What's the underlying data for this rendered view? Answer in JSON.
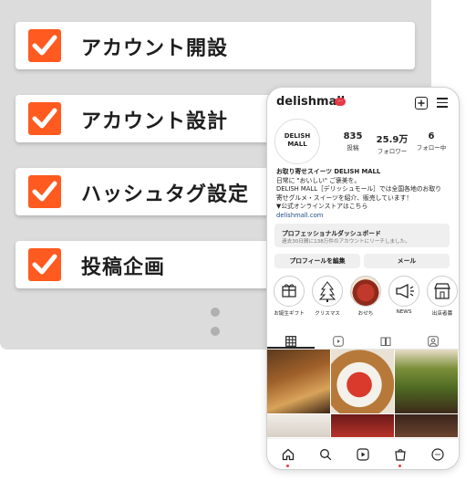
{
  "checklist": {
    "items": [
      {
        "label": "アカウント開設",
        "checked": true
      },
      {
        "label": "アカウント設計",
        "checked": true
      },
      {
        "label": "ハッシュタグ設定",
        "checked": true
      },
      {
        "label": "投稿企画",
        "checked": true
      }
    ],
    "accent_color": "#ff5a1f"
  },
  "phone": {
    "handle": "delishmall",
    "badge": "···",
    "avatar_text_1": "DELISH",
    "avatar_text_2": "MALL",
    "stats": [
      {
        "value": "835",
        "label": "投稿"
      },
      {
        "value": "25.9万",
        "label": "フォロワー"
      },
      {
        "value": "6",
        "label": "フォロー中"
      }
    ],
    "bio": {
      "name": "お取り寄せスイーツ DELISH MALL",
      "lines": [
        "日常に \"おいしい\" ご褒美を。",
        "DELISH MALL［デリッシュモール］では全国各地のお取り",
        "寄せグルメ・スイーツを紹介、販売しています！",
        "▼公式オンラインストアはこちら"
      ],
      "link": "delishmall.com"
    },
    "dashboard": {
      "title": "プロフェッショナルダッシュボード",
      "subtitle": "過去30日間に138万件のアカウントにリーチしました。"
    },
    "buttons": {
      "edit_profile": "プロフィールを編集",
      "email": "メール"
    },
    "highlights": [
      {
        "label": "お誕生ギフト",
        "icon": "gift-icon"
      },
      {
        "label": "クリスマス",
        "icon": "christmas-tree-icon"
      },
      {
        "label": "おせち",
        "icon": "osechi-photo"
      },
      {
        "label": "NEWS",
        "icon": "megaphone-icon"
      },
      {
        "label": "出店者募",
        "icon": "shop-icon"
      }
    ]
  }
}
